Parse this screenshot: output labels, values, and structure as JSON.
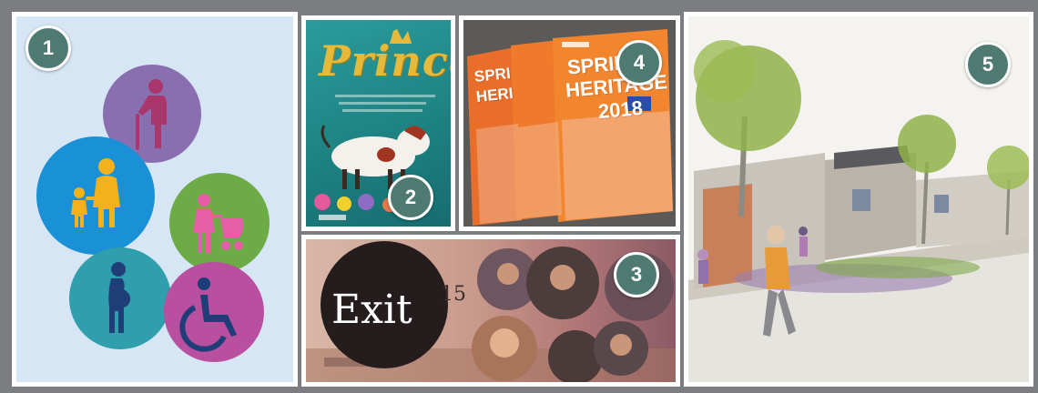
{
  "badges": {
    "b1": "1",
    "b2": "2",
    "b3": "3",
    "b4": "4",
    "b5": "5"
  },
  "panel2": {
    "title": "Prince"
  },
  "panel3": {
    "title": "Exit",
    "number": "15"
  },
  "panel4": {
    "line1": "SPRING",
    "line2": "HERITAGE",
    "year": "2018",
    "back_line1": "SPRI",
    "back_line2": "HERI"
  },
  "colors": {
    "frame": "#7b7d80",
    "badge": "#4f7a72",
    "panel1_bg": "#d6e6f5",
    "elderly": "#8a6fb0",
    "family": "#1a90d6",
    "stroller": "#6cab46",
    "pregnant": "#2f9fae",
    "wheelchair": "#b84f9f",
    "brochure": "#ef7a2c",
    "poster": "#1f8f8f"
  },
  "icons": [
    "elderly-person-icon",
    "parent-child-icon",
    "parent-stroller-icon",
    "pregnant-woman-icon",
    "wheelchair-icon"
  ]
}
